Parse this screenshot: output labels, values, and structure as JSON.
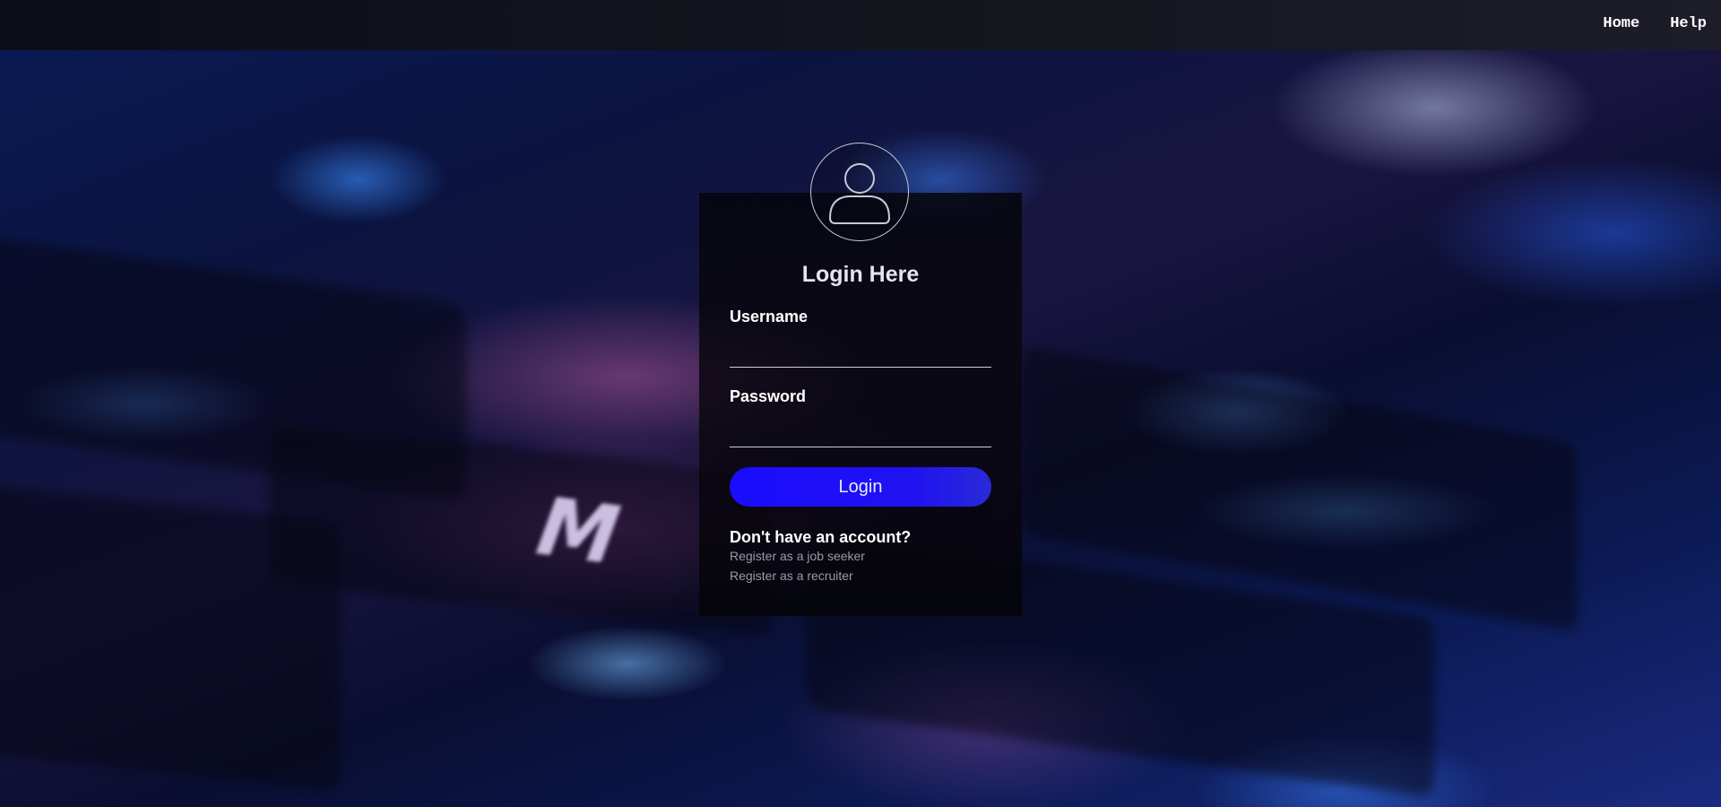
{
  "nav": {
    "items": [
      {
        "label": "Home"
      },
      {
        "label": "Help"
      }
    ]
  },
  "login_card": {
    "avatar_icon": "user-circle-icon",
    "title": "Login Here",
    "username_label": "Username",
    "username_value": "",
    "password_label": "Password",
    "password_value": "",
    "login_button": "Login",
    "no_account_text": "Don't have an account?",
    "register_links": [
      {
        "label": "Register as a job seeker"
      },
      {
        "label": "Register as a recruiter"
      }
    ]
  },
  "colors": {
    "button_accent": "#1a0cff",
    "card_background": "#07060e",
    "topbar": "#111320"
  }
}
